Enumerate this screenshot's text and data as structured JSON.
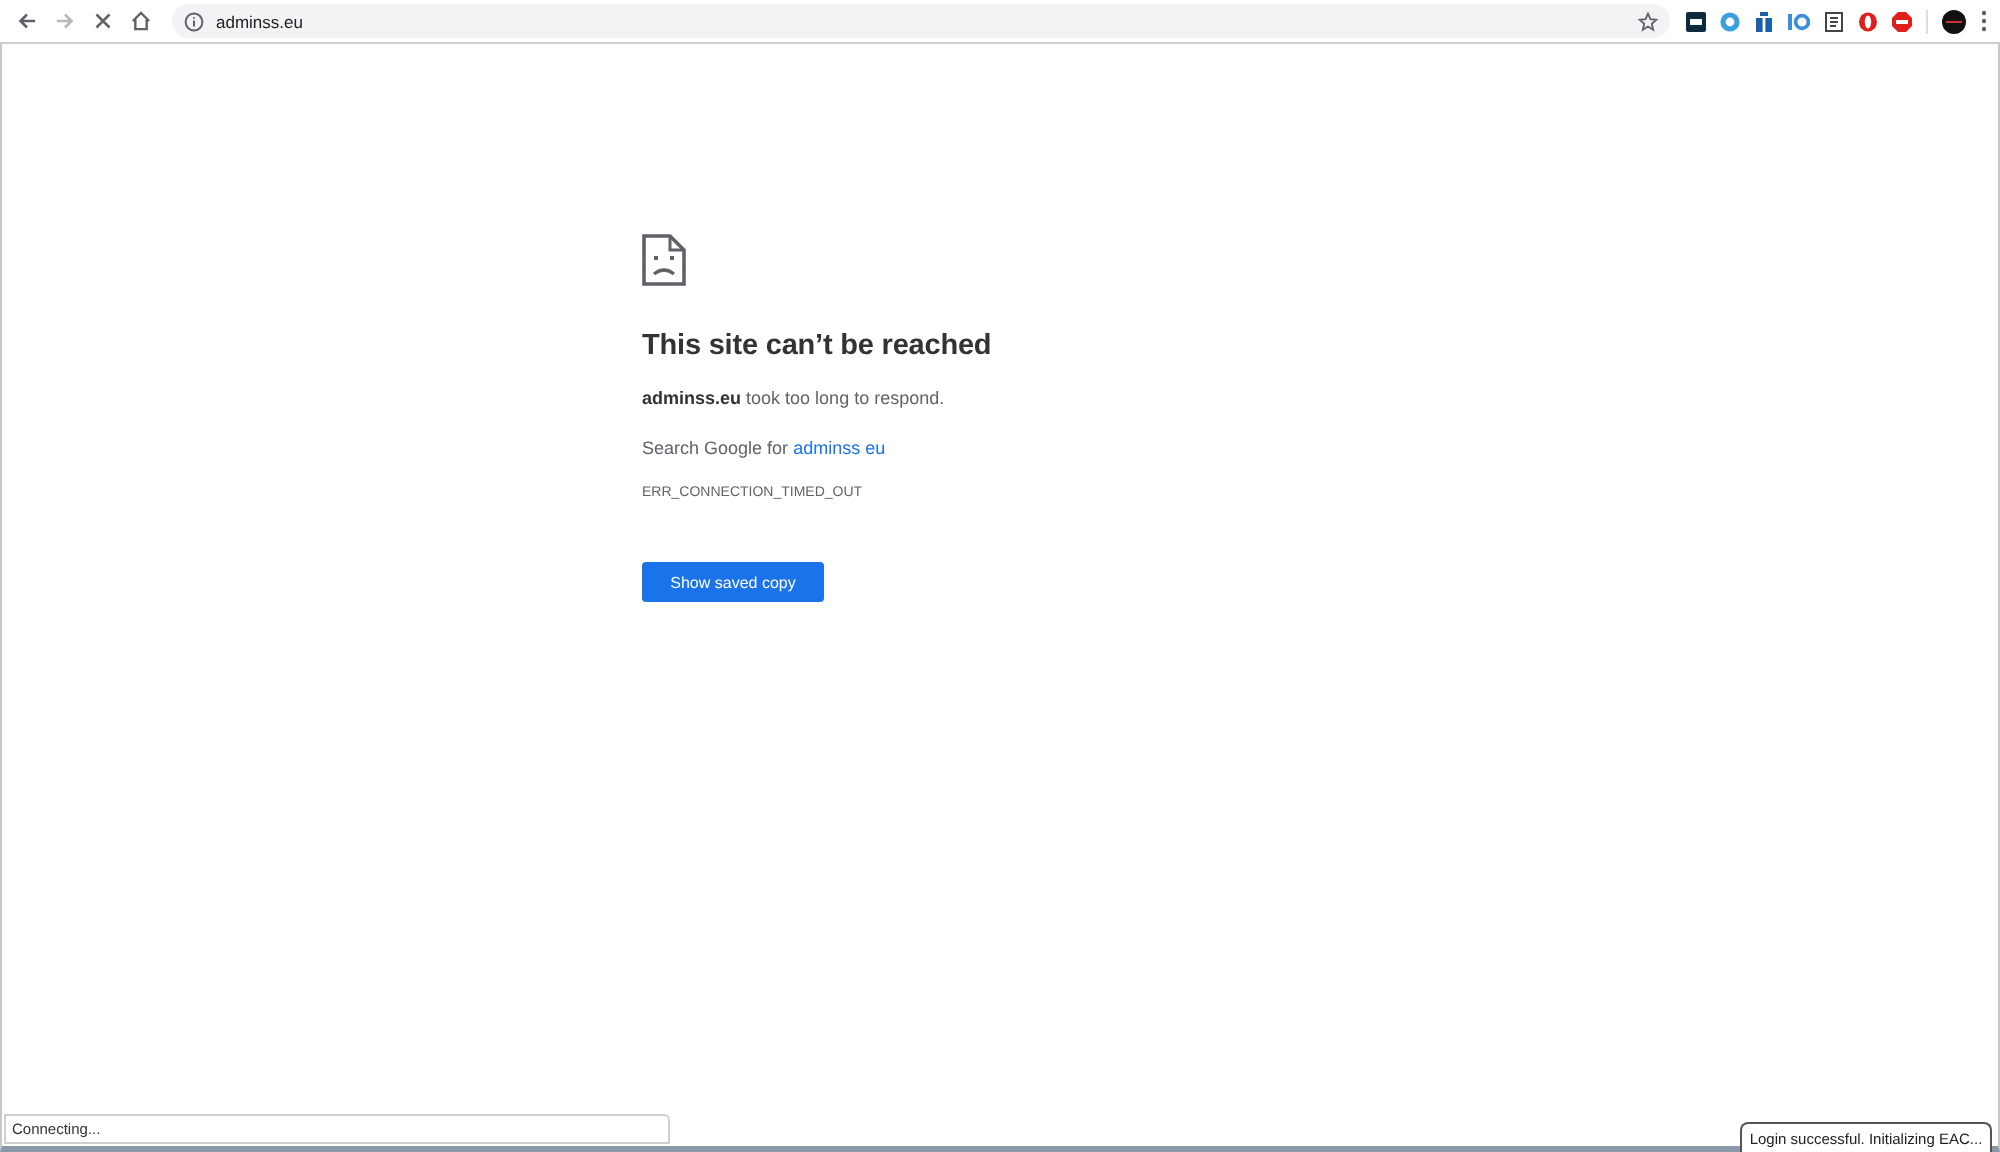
{
  "toolbar": {
    "nav_buttons": [
      {
        "kind": "back",
        "disabled": false
      },
      {
        "kind": "forward",
        "disabled": true
      },
      {
        "kind": "stop",
        "disabled": false
      },
      {
        "kind": "home",
        "disabled": false
      }
    ],
    "address": "adminss.eu"
  },
  "error_page": {
    "title": "This site can’t be reached",
    "message": "**adminss.eu** took too long to respond.",
    "search_prefix": "Search Google for",
    "search_link": "adminss eu",
    "error_code": "ERR_CONNECTION_TIMED_OUT",
    "button": "Show saved copy"
  },
  "status_bar": "Connecting...",
  "notification": "Login successful. Initializing EAC..."
}
